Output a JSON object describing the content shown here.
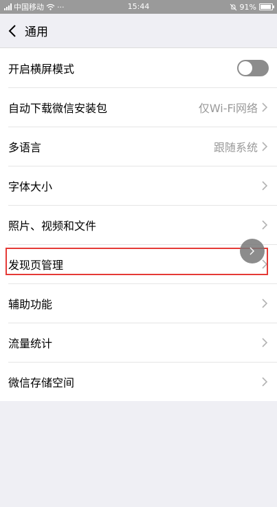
{
  "status_bar": {
    "carrier": "中国移动",
    "dots": "···",
    "time": "15:44",
    "battery": "91%",
    "battery_level": 0.91
  },
  "nav": {
    "title": "通用",
    "back_icon": "chevron-left-icon"
  },
  "settings": [
    {
      "label": "开启横屏模式",
      "control": "toggle",
      "toggle_on": false
    },
    {
      "label": "自动下载微信安装包",
      "value": "仅Wi-Fi网络"
    },
    {
      "label": "多语言",
      "value": "跟随系统"
    },
    {
      "label": "字体大小"
    },
    {
      "label": "照片、视频和文件"
    },
    {
      "label": "发现页管理"
    },
    {
      "label": "辅助功能"
    },
    {
      "label": "流量统计"
    },
    {
      "label": "微信存储空间"
    }
  ],
  "colors": {
    "highlight": "#e53935",
    "toggle_off": "#8c8c8c",
    "background": "#efeff4"
  }
}
